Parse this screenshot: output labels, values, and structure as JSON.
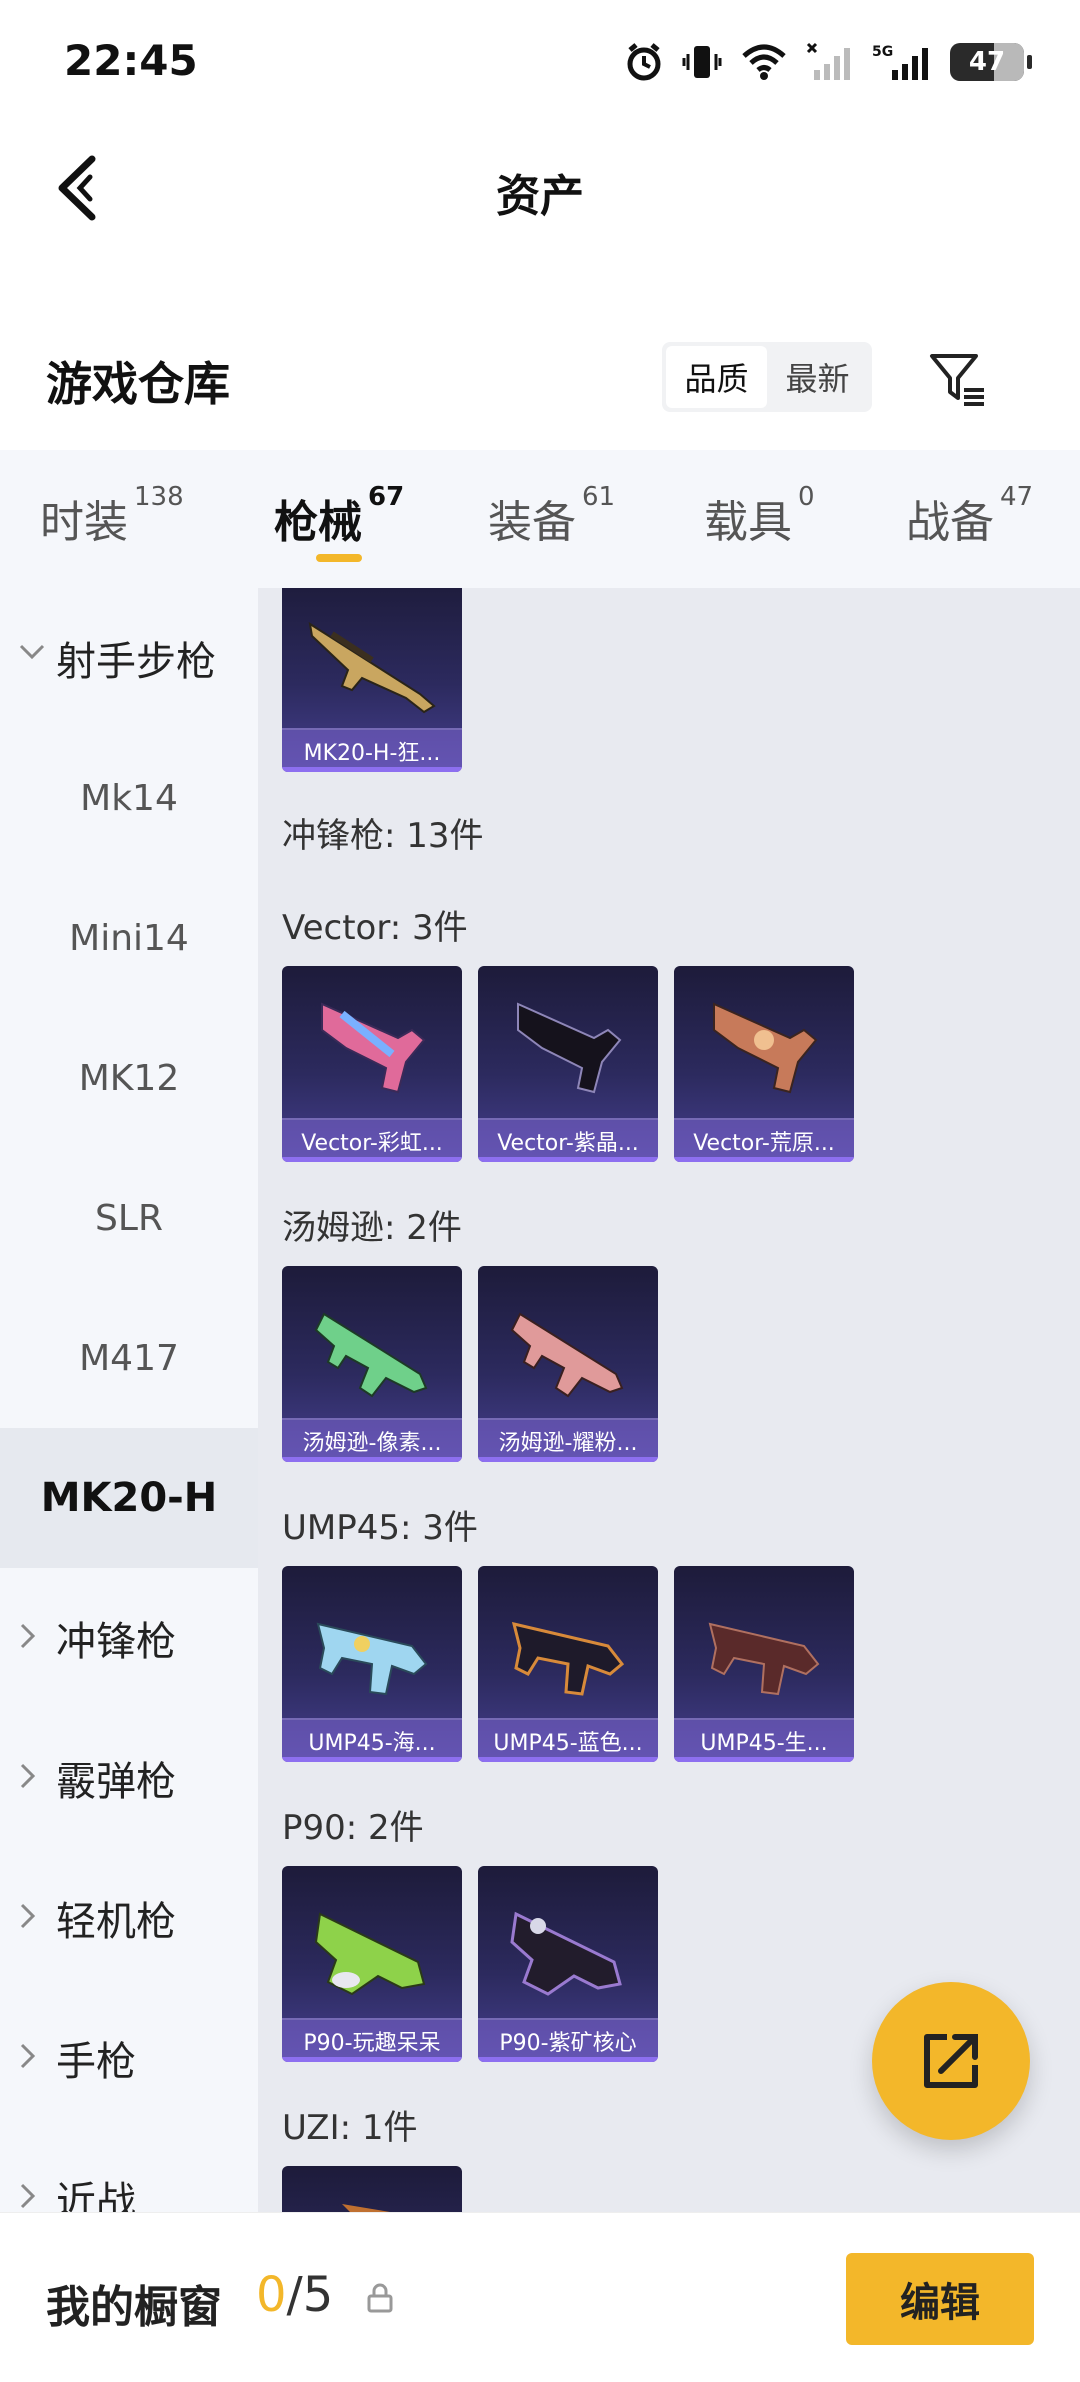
{
  "status_bar": {
    "time": "22:45",
    "battery": "47",
    "network": "5G"
  },
  "header": {
    "title": "资产"
  },
  "warehouse": {
    "title": "游戏仓库",
    "sort_options": [
      "品质",
      "最新"
    ],
    "active_sort": "品质"
  },
  "tabs": [
    {
      "label": "时装",
      "count": "138"
    },
    {
      "label": "枪械",
      "count": "67",
      "active": true
    },
    {
      "label": "装备",
      "count": "61"
    },
    {
      "label": "载具",
      "count": "0"
    },
    {
      "label": "战备",
      "count": "47"
    }
  ],
  "sidebar": {
    "items": [
      {
        "label": "射手步枪",
        "type": "category",
        "expanded": true
      },
      {
        "label": "Mk14"
      },
      {
        "label": "Mini14"
      },
      {
        "label": "MK12"
      },
      {
        "label": "SLR"
      },
      {
        "label": "M417"
      },
      {
        "label": "MK20-H",
        "active": true
      },
      {
        "label": "冲锋枪",
        "type": "category"
      },
      {
        "label": "霰弹枪",
        "type": "category"
      },
      {
        "label": "轻机枪",
        "type": "category"
      },
      {
        "label": "手枪",
        "type": "category"
      },
      {
        "label": "近战",
        "type": "category"
      }
    ]
  },
  "content": {
    "top_card": {
      "caption": "MK20-H-狂..."
    },
    "smg_header": "冲锋枪: 13件",
    "groups": [
      {
        "header": "Vector: 3件",
        "items": [
          "Vector-彩虹...",
          "Vector-紫晶...",
          "Vector-荒原..."
        ]
      },
      {
        "header": "汤姆逊: 2件",
        "items": [
          "汤姆逊-像素...",
          "汤姆逊-耀粉..."
        ]
      },
      {
        "header": "UMP45: 3件",
        "items": [
          "UMP45-海...",
          "UMP45-蓝色...",
          "UMP45-生..."
        ]
      },
      {
        "header": "P90: 2件",
        "items": [
          "P90-玩趣呆呆",
          "P90-紫矿核心"
        ]
      },
      {
        "header": "UZI: 1件",
        "items": [
          ""
        ]
      }
    ]
  },
  "bottom": {
    "showcase_label": "我的橱窗",
    "showcase_current": "0",
    "showcase_sep": "/",
    "showcase_max": "5",
    "edit_label": "编辑"
  },
  "colors": {
    "accent": "#f3b72a",
    "card_top": "#1d1b3a",
    "card_bottom": "#453f8e",
    "caption_bar": "#8d6ff0"
  }
}
